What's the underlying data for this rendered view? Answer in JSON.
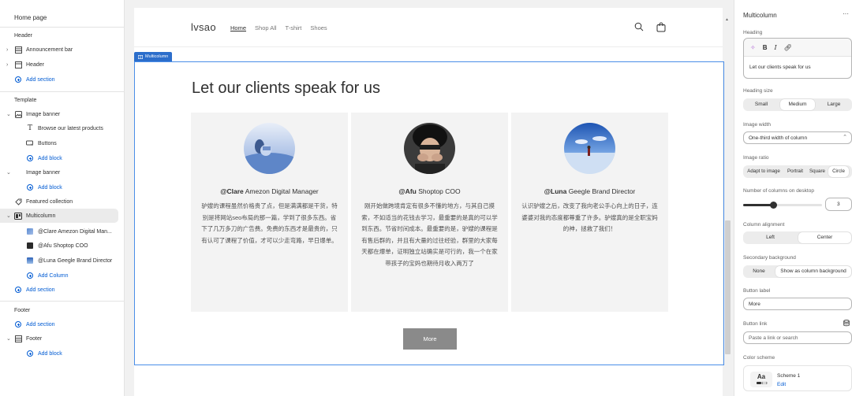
{
  "sidebar": {
    "title": "Home page",
    "header_group": "Header",
    "announcement_bar": "Announcement bar",
    "header_item": "Header",
    "add_section_1": "Add section",
    "template_group": "Template",
    "image_banner_1": "Image banner",
    "browse_text": "Browse our latest products",
    "buttons": "Buttons",
    "add_block_1": "Add block",
    "image_banner_2": "Image banner",
    "add_block_2": "Add block",
    "featured_collection": "Featured collection",
    "multicolumn": "Multicolumn",
    "col1": "@Clare Amezon Digital Man...",
    "col2": "@Afu Shoptop COO",
    "col3": "@Luna Geegle Brand Director",
    "add_column": "Add Column",
    "add_section_2": "Add section",
    "footer_group": "Footer",
    "add_section_3": "Add section",
    "footer_item": "Footer",
    "add_block_3": "Add block"
  },
  "store": {
    "logo": "lvsao",
    "nav": [
      "Home",
      "Shop All",
      "T-shirt",
      "Shoes"
    ],
    "section_tag": "Multicolumn",
    "heading": "Let our clients speak for us",
    "columns": [
      {
        "name": "@Clare",
        "role": " Amezon Digital Manager",
        "text": "驴嫂的课程虽然价格贵了点，但是满满都是干货，特别是将网站seo布局的那一篇，学到了很多东西。省下了几万多刀的广告费。免费的东西才是最贵的，只有认可了课程了价值，才可以少走弯路，早日爆单。"
      },
      {
        "name": "@Afu",
        "role": " Shoptop COO",
        "text": "刚开始做跨境肯定有很多不懂的地方，与其自己摸索，不如适当的花钱去学习，最重要的是真的可以学到东西。节省时间成本。最重要的是，驴嫂的课程是有售后群的，并且有大量的过往经验，群里的大家每天都在爆单，证明独立站确实是可行的，我一个在家带孩子的宝妈也期待月收入两万了"
      },
      {
        "name": "@Luna",
        "role": " Geegle Brand Director",
        "text": "认识驴嫂之后，改变了我向老公手心向上的日子，连婆婆对我的态度都尊重了许多。驴嫂真的是全职宝妈的神，拯救了我们！"
      }
    ],
    "button_label": "More"
  },
  "panel": {
    "title": "Multicolumn",
    "heading_label": "Heading",
    "heading_value": "Let our clients speak for us",
    "heading_size_label": "Heading size",
    "heading_size_options": [
      "Small",
      "Medium",
      "Large"
    ],
    "heading_size_selected": "Medium",
    "image_width_label": "Image width",
    "image_width_value": "One-third width of column",
    "image_ratio_label": "Image ratio",
    "image_ratio_options": [
      "Adapt to image",
      "Portrait",
      "Square",
      "Circle"
    ],
    "image_ratio_selected": "Circle",
    "columns_desktop_label": "Number of columns on desktop",
    "columns_desktop_value": "3",
    "columns_desktop_fraction": 0.38,
    "alignment_label": "Column alignment",
    "alignment_options": [
      "Left",
      "Center"
    ],
    "alignment_selected": "Center",
    "secondary_bg_label": "Secondary background",
    "secondary_bg_options": [
      "None",
      "Show as column background"
    ],
    "secondary_bg_selected": "Show as column background",
    "button_label_label": "Button label",
    "button_label_value": "More",
    "button_link_label": "Button link",
    "button_link_placeholder": "Paste a link or search",
    "color_scheme_label": "Color scheme",
    "color_scheme_swatch": "Aa",
    "color_scheme_name": "Scheme 1",
    "color_scheme_edit": "Edit"
  },
  "colors": {
    "accent_blue": "#005bd3",
    "selection_outline": "#4a8ee8",
    "tag_blue": "#2c6ecb",
    "button_grey": "#8a8a8a"
  }
}
